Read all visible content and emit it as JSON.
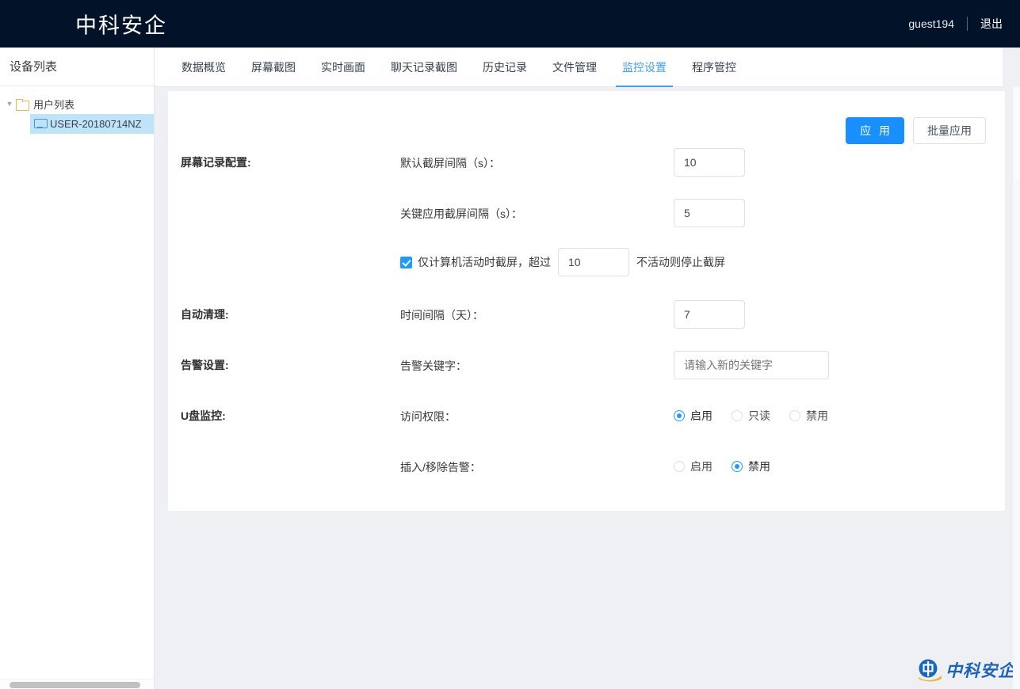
{
  "header": {
    "brand": "中科安企",
    "user": "guest194",
    "logout": "退出"
  },
  "sidebar": {
    "title": "设备列表",
    "tree": {
      "root_label": "用户列表",
      "caret_icon": "caret-down-icon",
      "folder_icon": "folder-icon",
      "children": [
        {
          "label": "USER-20180714NZ",
          "icon": "monitor-icon",
          "selected": true
        }
      ]
    }
  },
  "tabs": [
    {
      "label": "数据概览",
      "active": false
    },
    {
      "label": "屏幕截图",
      "active": false
    },
    {
      "label": "实时画面",
      "active": false
    },
    {
      "label": "聊天记录截图",
      "active": false
    },
    {
      "label": "历史记录",
      "active": false
    },
    {
      "label": "文件管理",
      "active": false
    },
    {
      "label": "监控设置",
      "active": true
    },
    {
      "label": "程序管控",
      "active": false
    }
  ],
  "toolbar": {
    "apply_label": "应 用",
    "batch_apply_label": "批量应用"
  },
  "form": {
    "screen_record": {
      "group_label": "屏幕记录配置:",
      "default_interval_label": "默认截屏间隔（s）：",
      "default_interval_value": "10",
      "key_app_interval_label": "关键应用截屏间隔（s）：",
      "key_app_interval_value": "5",
      "activity_only_prefix": "仅计算机活动时截屏，超过",
      "activity_only_value": "10",
      "activity_only_suffix": "不活动则停止截屏",
      "activity_only_checked": true
    },
    "auto_clean": {
      "group_label": "自动清理:",
      "interval_label": "时间间隔（天）：",
      "interval_value": "7"
    },
    "alarm": {
      "group_label": "告警设置:",
      "keyword_label": "告警关键字：",
      "keyword_value": "",
      "keyword_placeholder": "请输入新的关键字"
    },
    "udisk": {
      "group_label": "U盘监控:",
      "access_label": "访问权限：",
      "access_options": [
        {
          "label": "启用",
          "checked": true
        },
        {
          "label": "只读",
          "checked": false
        },
        {
          "label": "禁用",
          "checked": false
        }
      ],
      "plug_alarm_label": "插入/移除告警：",
      "plug_alarm_options": [
        {
          "label": "启用",
          "checked": false
        },
        {
          "label": "禁用",
          "checked": true
        }
      ]
    }
  },
  "watermark": {
    "text": "中科安企",
    "mark_icon": "zhongke-anqi-logo-icon"
  },
  "colors": {
    "header_bg": "#021229",
    "accent": "#409eff",
    "primary_button": "#1890ff",
    "page_bg": "#eef0f4",
    "selected_tree_bg": "#bfe3f7"
  }
}
